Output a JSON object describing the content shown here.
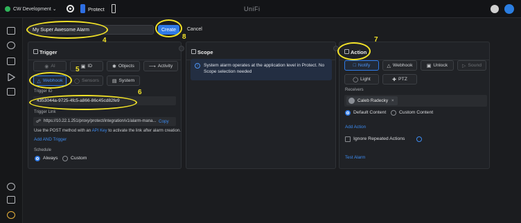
{
  "topbar": {
    "console_name": "CW Development",
    "app_name": "Protect",
    "brand": "UniFi"
  },
  "alarm": {
    "name_value": "My Super Awesome Alarm",
    "create_label": "Create",
    "cancel_label": "Cancel"
  },
  "trigger": {
    "title": "Trigger",
    "buttons": [
      "AI",
      "ID",
      "Objects",
      "Activity",
      "Webhook",
      "Sensors",
      "System"
    ],
    "selected": "Webhook",
    "trigger_id_label": "Trigger ID",
    "trigger_id_value": "4353044a-9725-4fc5-a866-86c45cd82fe9",
    "trigger_link_label": "Trigger Link",
    "trigger_link_value": "https://10.22.1.251/proxy/protect/integration/v1/alarm-mana...",
    "copy_label": "Copy",
    "help_prefix": "Use the POST method with an",
    "help_link": "API Key",
    "help_suffix": "to activate the link after alarm creation.",
    "add_and_trigger": "Add AND Trigger",
    "schedule_label": "Schedule",
    "schedule_options": [
      "Always",
      "Custom"
    ],
    "schedule_selected": "Always"
  },
  "scope": {
    "title": "Scope",
    "info": "System alarm operates at the application level in Protect. No Scope selection needed"
  },
  "action": {
    "title": "Action",
    "buttons": [
      "Notify",
      "Webhook",
      "Unlock",
      "Sound",
      "Light",
      "PTZ"
    ],
    "selected": "Notify",
    "receivers_label": "Receivers",
    "receiver_chip": "Caleb Radecky",
    "content_options": [
      "Default Content",
      "Custom Content"
    ],
    "content_selected": "Default Content",
    "add_action": "Add Action",
    "ignore_repeated": "Ignore Repeated Actions",
    "test_alarm": "Test Alarm"
  },
  "annotations": [
    "4",
    "5",
    "6",
    "7",
    "8"
  ],
  "colors": {
    "accent": "#2f7ae6",
    "annotation": "#f2e228",
    "background": "#1b1c1f",
    "panel": "#202226"
  },
  "icons": {
    "console": "green-dot-icon",
    "app": "protect-icon",
    "sidebar": [
      "grid-icon",
      "compass-icon",
      "layers-icon",
      "play-icon",
      "folder-icon",
      "gear-icon",
      "clipboard-icon",
      "bug-icon"
    ]
  }
}
